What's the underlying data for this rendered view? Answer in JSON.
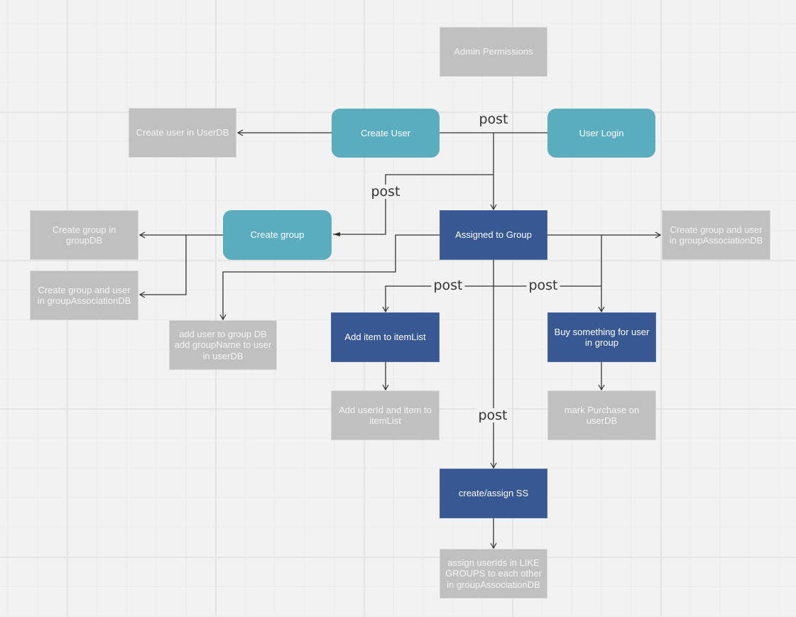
{
  "diagram": {
    "colors": {
      "background": "#f2f2f2",
      "db_node": "#bfc0bf",
      "api_node": "#5aacbf",
      "process_node": "#375893",
      "connector": "#333333"
    },
    "nodes": {
      "admin_permissions": {
        "label": "Admin Permissions",
        "type": "db"
      },
      "create_user_in_userdb": {
        "label": "Create user in UserDB",
        "type": "db"
      },
      "create_user": {
        "label": "Create User",
        "type": "api"
      },
      "user_login": {
        "label": "User Login",
        "type": "api"
      },
      "create_group_in_groupdb": {
        "label": "Create group in groupDB",
        "type": "db"
      },
      "create_group": {
        "label": "Create group",
        "type": "api"
      },
      "assigned_to_group": {
        "label": "Assigned to Group",
        "type": "process"
      },
      "create_group_assoc_right": {
        "label": "Create group and user in groupAssociationDB",
        "type": "db"
      },
      "create_group_assoc_left": {
        "label": "Create group and user in groupAssociationDB",
        "type": "db"
      },
      "add_user_to_group_db": {
        "label": "add user to group DB add groupName to user in userDB",
        "type": "db"
      },
      "add_item_to_itemlist": {
        "label": "Add item to itemList",
        "type": "process"
      },
      "buy_something": {
        "label": "Buy something for user in group",
        "type": "process"
      },
      "add_userid_item": {
        "label": "Add userId and item to itemList",
        "type": "db"
      },
      "mark_purchase": {
        "label": "mark Purchase on userDB",
        "type": "db"
      },
      "create_assign_ss": {
        "label": "create/assign SS",
        "type": "process"
      },
      "assign_userids": {
        "label": "assign userIds in LIKE GROUPS to each other in groupAssociationDB",
        "type": "db"
      }
    },
    "edge_labels": {
      "login_post": "post",
      "create_group_post": "post",
      "add_item_post": "post",
      "buy_post": "post",
      "ss_post": "post"
    },
    "edges": [
      {
        "from": "Create User",
        "to": "Create user in UserDB"
      },
      {
        "from": "Create User",
        "to": "Assigned to Group",
        "label": "post"
      },
      {
        "from": "User Login",
        "to": "Assigned to Group",
        "label": "post"
      },
      {
        "from": "User Login",
        "to": "Create group",
        "label": "post"
      },
      {
        "from": "Create group",
        "to": "Create group in groupDB"
      },
      {
        "from": "Create group",
        "to": "Create group and user in groupAssociationDB"
      },
      {
        "from": "Assigned to Group",
        "to": "add user to group DB add groupName to user in userDB"
      },
      {
        "from": "Assigned to Group",
        "to": "Create group and user in groupAssociationDB"
      },
      {
        "from": "Assigned to Group",
        "to": "Add item to itemList",
        "label": "post"
      },
      {
        "from": "Assigned to Group",
        "to": "Buy something for user in group",
        "label": "post"
      },
      {
        "from": "Assigned to Group",
        "to": "create/assign SS",
        "label": "post"
      },
      {
        "from": "Add item to itemList",
        "to": "Add userId and item to itemList"
      },
      {
        "from": "Buy something for user in group",
        "to": "mark Purchase on userDB"
      },
      {
        "from": "create/assign SS",
        "to": "assign userIds in LIKE GROUPS to each other in groupAssociationDB"
      }
    ]
  }
}
